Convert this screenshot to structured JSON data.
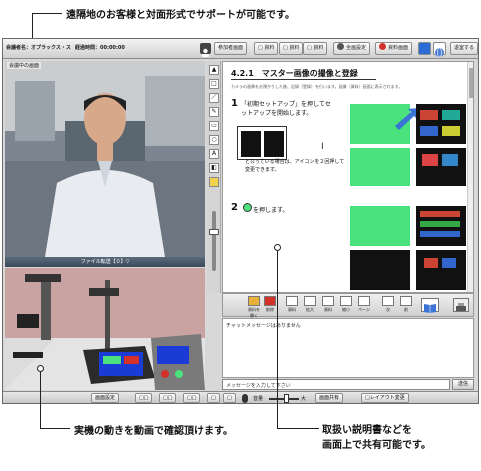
{
  "callouts": {
    "top": "遠隔地のお客様と対面形式でサポートが可能です。",
    "bottom_left": "実機の動きを動画で確認頂けます。",
    "bottom_right_line1": "取扱い説明書などを",
    "bottom_right_line2": "画面上で共有可能です。"
  },
  "topbar": {
    "user_name": "会議者名：オプラックス・ス",
    "elapsed_time": "経過時間：00:00:00",
    "buttons": [
      "参加者画面",
      "□ 資料",
      "□ 資料",
      "□ 資料",
      "全画設定",
      "資料画面",
      "退室する"
    ]
  },
  "video": {
    "label": "会議中の画面"
  },
  "document": {
    "heading": "4.2.1　マスター画像の撮像と登録",
    "intro": "カメラの画像をお預かりした後、記録（登録）を行います。画像（資料）画面に表示されます。",
    "step1_number": "1",
    "step1_text": "「初期セットアップ」を押してセットアップを開始します。",
    "step1_note": "となっている場合は、アイコンを２回押して変更できます。",
    "step2_number": "2",
    "step2_text": "を押します。"
  },
  "file_transfer": {
    "label": "ファイル転送【０】▽"
  },
  "doc_tools": [
    "資料を開く",
    "削除",
    "資料",
    "拡大",
    "資料",
    "縮小",
    "ページ",
    "次",
    "前"
  ],
  "chat": {
    "message": "チャットメッセージはありません",
    "input_placeholder": "メッセージを入力して下さい",
    "send_label": "送信"
  },
  "bottombar": {
    "buttons": [
      "画面設定",
      "□□",
      "□□",
      "□□",
      "□",
      "□",
      "音量",
      "大",
      "画面共有",
      "□レイアウト変更"
    ]
  },
  "colors": {
    "green_screen": "#49e27d",
    "device_blue": "#1b3bd6",
    "accent_red": "#d3322a",
    "accent_blue": "#2d6bd6"
  }
}
